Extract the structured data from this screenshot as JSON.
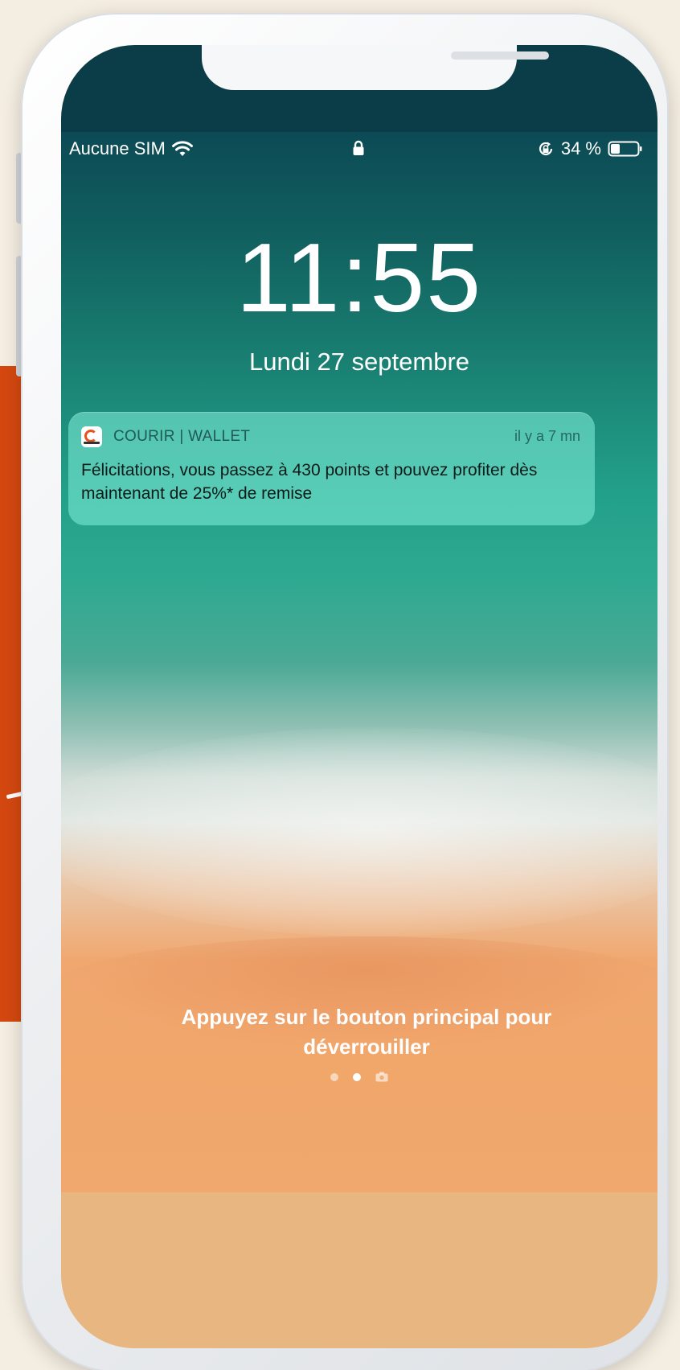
{
  "status_bar": {
    "carrier": "Aucune SIM",
    "battery_percent": "34 %",
    "battery_level": 0.34,
    "icons": [
      "wifi-icon",
      "lock-icon",
      "rotation-lock-icon",
      "battery-icon"
    ]
  },
  "lock_screen": {
    "time": "11:55",
    "date": "Lundi 27 septembre"
  },
  "notification": {
    "app_name": "COURIR | WALLET",
    "time_ago": "il y a 7 mn",
    "message": "Félicitations, vous passez à 430 points et pouvez profiter dès maintenant de 25%* de remise",
    "app_icon": "courir-app-icon"
  },
  "unlock": {
    "hint": "Appuyez sur le bouton principal pour déverrouiller"
  },
  "page_indicator": {
    "count": 2,
    "active_index": 1,
    "trailing_icon": "camera-icon"
  },
  "colors": {
    "promo_accent": "#d44810",
    "notification_bg": "#78e6d2",
    "app_brand": "#e8501c"
  }
}
